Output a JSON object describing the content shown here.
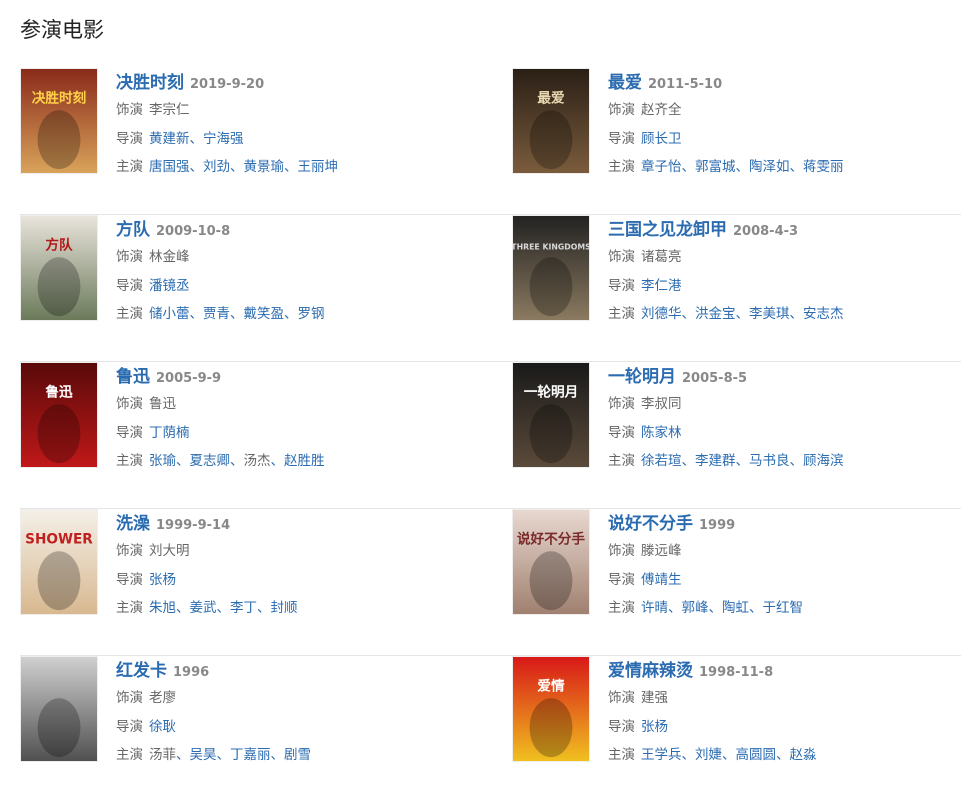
{
  "section_title": "参演电影",
  "labels": {
    "role": "饰演",
    "director": "导演",
    "cast": "主演",
    "sep": "、"
  },
  "movies": [
    {
      "title": "决胜时刻",
      "date": "2019-9-20",
      "role": "李宗仁",
      "directors": [
        "黄建新",
        "宁海强"
      ],
      "cast": [
        "唐国强",
        "刘劲",
        "黄景瑜",
        "王丽坤"
      ]
    },
    {
      "title": "最爱",
      "date": "2011-5-10",
      "role": "赵齐全",
      "directors": [
        "顾长卫"
      ],
      "cast": [
        "章子怡",
        "郭富城",
        "陶泽如",
        "蒋雯丽"
      ]
    },
    {
      "title": "方队",
      "date": "2009-10-8",
      "role": "林金峰",
      "directors": [
        "潘镜丞"
      ],
      "cast": [
        "储小蕾",
        "贾青",
        "戴笑盈",
        "罗钢"
      ]
    },
    {
      "title": "三国之见龙卸甲",
      "date": "2008-4-3",
      "role": "诸葛亮",
      "directors": [
        "李仁港"
      ],
      "cast": [
        "刘德华",
        "洪金宝",
        "李美琪",
        "安志杰"
      ]
    },
    {
      "title": "鲁迅",
      "date": "2005-9-9",
      "role": "鲁迅",
      "directors": [
        "丁荫楠"
      ],
      "cast": [
        "张瑜",
        "夏志卿",
        "汤杰",
        "赵胜胜"
      ],
      "cast_plain": [
        2
      ]
    },
    {
      "title": "一轮明月",
      "date": "2005-8-5",
      "role": "李叔同",
      "directors": [
        "陈家林"
      ],
      "cast": [
        "徐若瑄",
        "李建群",
        "马书良",
        "顾海滨"
      ]
    },
    {
      "title": "洗澡",
      "date": "1999-9-14",
      "role": "刘大明",
      "directors": [
        "张杨"
      ],
      "cast": [
        "朱旭",
        "姜武",
        "李丁",
        "封顺"
      ]
    },
    {
      "title": "说好不分手",
      "date": "1999",
      "role": "滕远峰",
      "directors": [
        "傅靖生"
      ],
      "cast": [
        "许晴",
        "郭峰",
        "陶虹",
        "于红智"
      ]
    },
    {
      "title": "红发卡",
      "date": "1996",
      "role": "老廖",
      "directors": [
        "徐耿"
      ],
      "cast": [
        "汤菲",
        "吴昊",
        "丁嘉丽",
        "剧雪"
      ],
      "cast_plain": [
        0
      ]
    },
    {
      "title": "爱情麻辣烫",
      "date": "1998-11-8",
      "role": "建强",
      "directors": [
        "张杨"
      ],
      "cast": [
        "王学兵",
        "刘婕",
        "高圆圆",
        "赵淼"
      ]
    }
  ],
  "posters": [
    {
      "name": "poster-juesheng",
      "bg": [
        "#8a2a1a",
        "#d9a35a"
      ],
      "text": "决胜时刻",
      "text_color": "#ffd24a"
    },
    {
      "name": "poster-zuiai",
      "bg": [
        "#2a1f16",
        "#7a5c3c"
      ],
      "text": "最爱",
      "text_color": "#e8d8b0"
    },
    {
      "name": "poster-fangdui",
      "bg": [
        "#e9e4dc",
        "#6b7a5a"
      ],
      "text": "方队",
      "text_color": "#b01818"
    },
    {
      "name": "poster-sanguo",
      "bg": [
        "#222",
        "#8a7a60"
      ],
      "text": "THREE KINGDOMS",
      "text_color": "#d8d8d8"
    },
    {
      "name": "poster-luxun",
      "bg": [
        "#5a0a0a",
        "#c01818"
      ],
      "text": "鲁迅",
      "text_color": "#ffffff"
    },
    {
      "name": "poster-yilun",
      "bg": [
        "#1a1a1a",
        "#5a4a3a"
      ],
      "text": "一轮明月",
      "text_color": "#ffffff"
    },
    {
      "name": "poster-xizao",
      "bg": [
        "#f4f0e8",
        "#d8b890"
      ],
      "text": "SHOWER",
      "text_color": "#c02020"
    },
    {
      "name": "poster-shuohao",
      "bg": [
        "#e8d8d0",
        "#a08070"
      ],
      "text": "说好不分手",
      "text_color": "#7a2a2a"
    },
    {
      "name": "poster-hongfa",
      "bg": [
        "#d0d0d0",
        "#505050"
      ],
      "text": "",
      "text_color": "#ffffff"
    },
    {
      "name": "poster-aiqing",
      "bg": [
        "#d81818",
        "#f0c020"
      ],
      "text": "爱情",
      "text_color": "#ffffff"
    }
  ]
}
